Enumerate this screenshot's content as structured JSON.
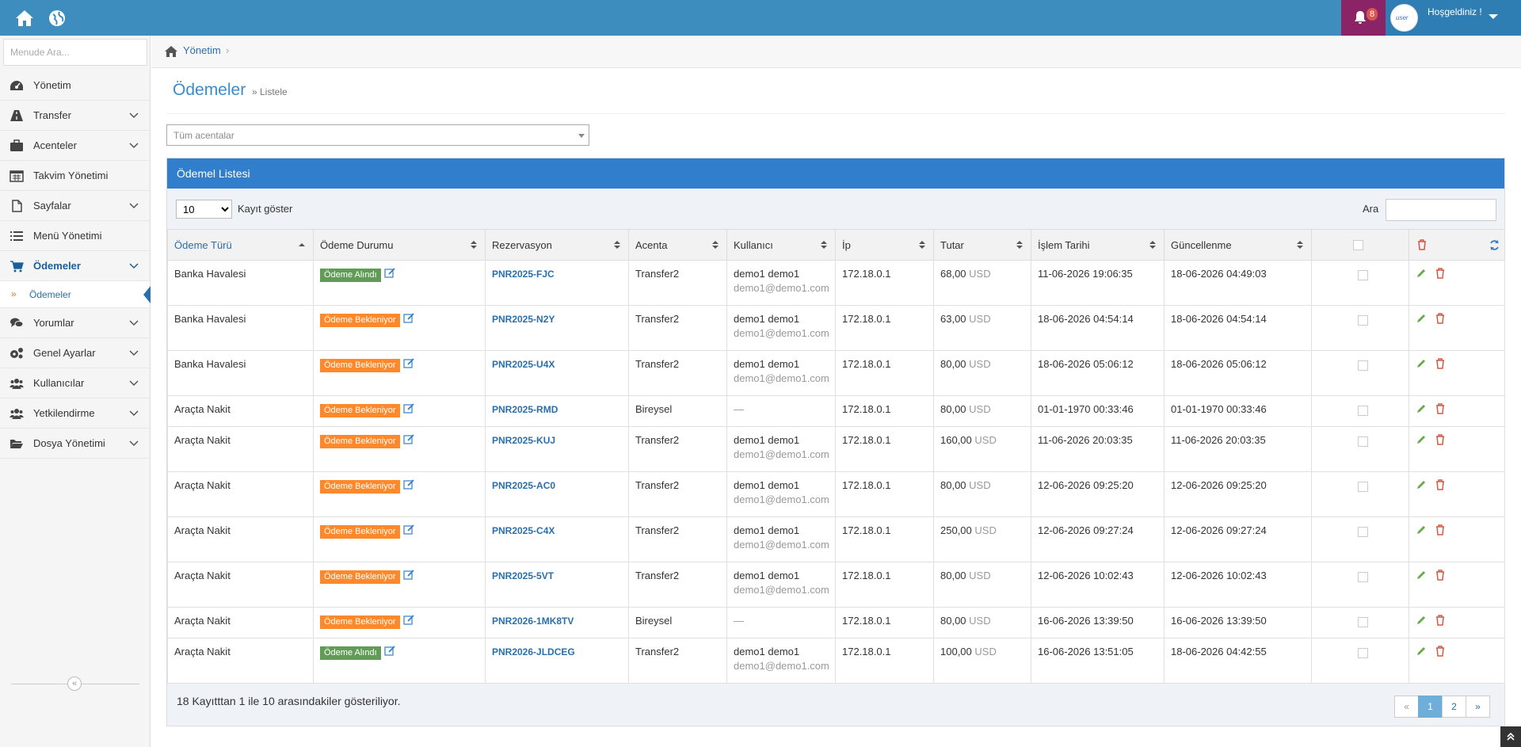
{
  "topbar": {
    "notification_count": "8",
    "welcome": "Hoşgeldiniz !"
  },
  "sidebar": {
    "search_placeholder": "Menude Ara...",
    "items": [
      {
        "label": "Yönetim",
        "icon": "dashboard-icon"
      },
      {
        "label": "Transfer",
        "icon": "road-icon"
      },
      {
        "label": "Acenteler",
        "icon": "briefcase-icon"
      },
      {
        "label": "Takvim Yönetimi",
        "icon": "calendar-icon"
      },
      {
        "label": "Sayfalar",
        "icon": "file-icon"
      },
      {
        "label": "Menü Yönetimi",
        "icon": "list-icon"
      },
      {
        "label": "Ödemeler",
        "icon": "cart-icon"
      },
      {
        "label": "Yorumlar",
        "icon": "comments-icon"
      },
      {
        "label": "Genel Ayarlar",
        "icon": "cogs-icon"
      },
      {
        "label": "Kullanıcılar",
        "icon": "users-icon"
      },
      {
        "label": "Yetkilendirme",
        "icon": "users-icon"
      },
      {
        "label": "Dosya Yönetimi",
        "icon": "folder-icon"
      }
    ],
    "subitem": "Ödemeler"
  },
  "breadcrumb": {
    "link": "Yönetim",
    "sep": "›"
  },
  "page": {
    "title": "Ödemeler",
    "subtitle": "» Listele"
  },
  "agency_select": "Tüm acentalar",
  "panel": {
    "title": "Ödemel Listesi",
    "page_length": "10",
    "length_label": "Kayıt göster",
    "search_label": "Ara"
  },
  "columns": [
    "Ödeme Türü",
    "Ödeme Durumu",
    "Rezervasyon",
    "Acenta",
    "Kullanıcı",
    "İp",
    "Tutar",
    "İşlem Tarihi",
    "Güncellenme"
  ],
  "rows": [
    {
      "type": "Banka Havalesi",
      "status": "Ödeme Alındı",
      "pnr": "PNR2025-FJC",
      "agency": "Transfer2",
      "user": "demo1 demo1",
      "email": "demo1@demo1.com",
      "ip": "172.18.0.1",
      "amount": "68,00",
      "currency": "USD",
      "date": "11-06-2026 19:06:35",
      "updated": "18-06-2026 04:49:03"
    },
    {
      "type": "Banka Havalesi",
      "status": "Ödeme Bekleniyor",
      "pnr": "PNR2025-N2Y",
      "agency": "Transfer2",
      "user": "demo1 demo1",
      "email": "demo1@demo1.com",
      "ip": "172.18.0.1",
      "amount": "63,00",
      "currency": "USD",
      "date": "18-06-2026 04:54:14",
      "updated": "18-06-2026 04:54:14"
    },
    {
      "type": "Banka Havalesi",
      "status": "Ödeme Bekleniyor",
      "pnr": "PNR2025-U4X",
      "agency": "Transfer2",
      "user": "demo1 demo1",
      "email": "demo1@demo1.com",
      "ip": "172.18.0.1",
      "amount": "80,00",
      "currency": "USD",
      "date": "18-06-2026 05:06:12",
      "updated": "18-06-2026 05:06:12"
    },
    {
      "type": "Araçta Nakit",
      "status": "Ödeme Bekleniyor",
      "pnr": "PNR2025-RMD",
      "agency": "Bireysel",
      "user": "—",
      "email": "",
      "ip": "172.18.0.1",
      "amount": "80,00",
      "currency": "USD",
      "date": "01-01-1970 00:33:46",
      "updated": "01-01-1970 00:33:46"
    },
    {
      "type": "Araçta Nakit",
      "status": "Ödeme Bekleniyor",
      "pnr": "PNR2025-KUJ",
      "agency": "Transfer2",
      "user": "demo1 demo1",
      "email": "demo1@demo1.com",
      "ip": "172.18.0.1",
      "amount": "160,00",
      "currency": "USD",
      "date": "11-06-2026 20:03:35",
      "updated": "11-06-2026 20:03:35"
    },
    {
      "type": "Araçta Nakit",
      "status": "Ödeme Bekleniyor",
      "pnr": "PNR2025-AC0",
      "agency": "Transfer2",
      "user": "demo1 demo1",
      "email": "demo1@demo1.com",
      "ip": "172.18.0.1",
      "amount": "80,00",
      "currency": "USD",
      "date": "12-06-2026 09:25:20",
      "updated": "12-06-2026 09:25:20"
    },
    {
      "type": "Araçta Nakit",
      "status": "Ödeme Bekleniyor",
      "pnr": "PNR2025-C4X",
      "agency": "Transfer2",
      "user": "demo1 demo1",
      "email": "demo1@demo1.com",
      "ip": "172.18.0.1",
      "amount": "250,00",
      "currency": "USD",
      "date": "12-06-2026 09:27:24",
      "updated": "12-06-2026 09:27:24"
    },
    {
      "type": "Araçta Nakit",
      "status": "Ödeme Bekleniyor",
      "pnr": "PNR2025-5VT",
      "agency": "Transfer2",
      "user": "demo1 demo1",
      "email": "demo1@demo1.com",
      "ip": "172.18.0.1",
      "amount": "80,00",
      "currency": "USD",
      "date": "12-06-2026 10:02:43",
      "updated": "12-06-2026 10:02:43"
    },
    {
      "type": "Araçta Nakit",
      "status": "Ödeme Bekleniyor",
      "pnr": "PNR2026-1MK8TV",
      "agency": "Bireysel",
      "user": "—",
      "email": "",
      "ip": "172.18.0.1",
      "amount": "80,00",
      "currency": "USD",
      "date": "16-06-2026 13:39:50",
      "updated": "16-06-2026 13:39:50"
    },
    {
      "type": "Araçta Nakit",
      "status": "Ödeme Alındı",
      "pnr": "PNR2026-JLDCEG",
      "agency": "Transfer2",
      "user": "demo1 demo1",
      "email": "demo1@demo1.com",
      "ip": "172.18.0.1",
      "amount": "100,00",
      "currency": "USD",
      "date": "16-06-2026 13:51:05",
      "updated": "18-06-2026 04:42:55"
    }
  ],
  "footer": {
    "info": "18 Kayıtttan 1 ile 10 arasındakiler gösteriliyor.",
    "pages": [
      "«",
      "1",
      "2",
      "»"
    ]
  },
  "colors": {
    "topbar": "#3d8ebf",
    "panel_head": "#307ecc",
    "paid": "#629b58",
    "pending": "#ff892a",
    "link": "#2a6fad"
  }
}
